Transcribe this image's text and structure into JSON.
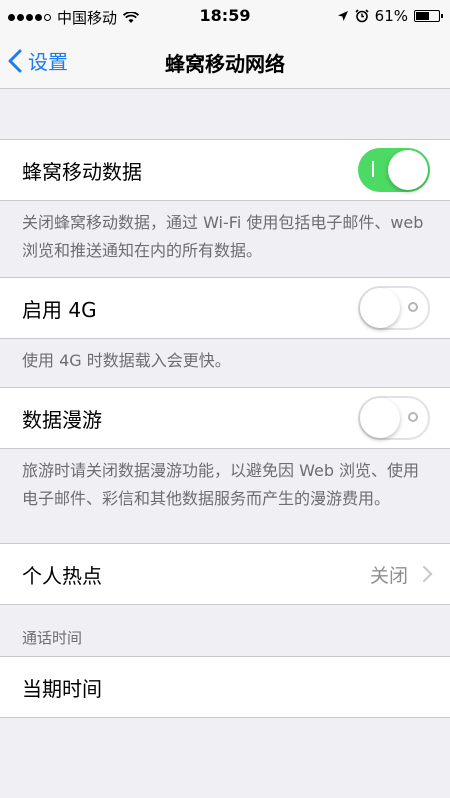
{
  "status": {
    "carrier": "中国移动",
    "time": "18:59",
    "battery": "61%",
    "battery_level": 0.61
  },
  "nav": {
    "back_label": "设置",
    "title": "蜂窝移动网络"
  },
  "cellular_data": {
    "label": "蜂窝移动数据",
    "enabled": true,
    "footer": "关闭蜂窝移动数据，通过 Wi-Fi 使用包括电子邮件、web 浏览和推送通知在内的所有数据。"
  },
  "enable_4g": {
    "label": "启用 4G",
    "enabled": false,
    "footer": "使用 4G 时数据载入会更快。"
  },
  "data_roaming": {
    "label": "数据漫游",
    "enabled": false,
    "footer": "旅游时请关闭数据漫游功能，以避免因 Web 浏览、使用电子邮件、彩信和其他数据服务而产生的漫游费用。"
  },
  "hotspot": {
    "label": "个人热点",
    "value": "关闭"
  },
  "call_time": {
    "header": "通话时间",
    "current_period_label": "当期时间"
  },
  "colors": {
    "accent": "#1b7cf3",
    "toggle_on": "#4cd964",
    "background": "#efeff4"
  }
}
